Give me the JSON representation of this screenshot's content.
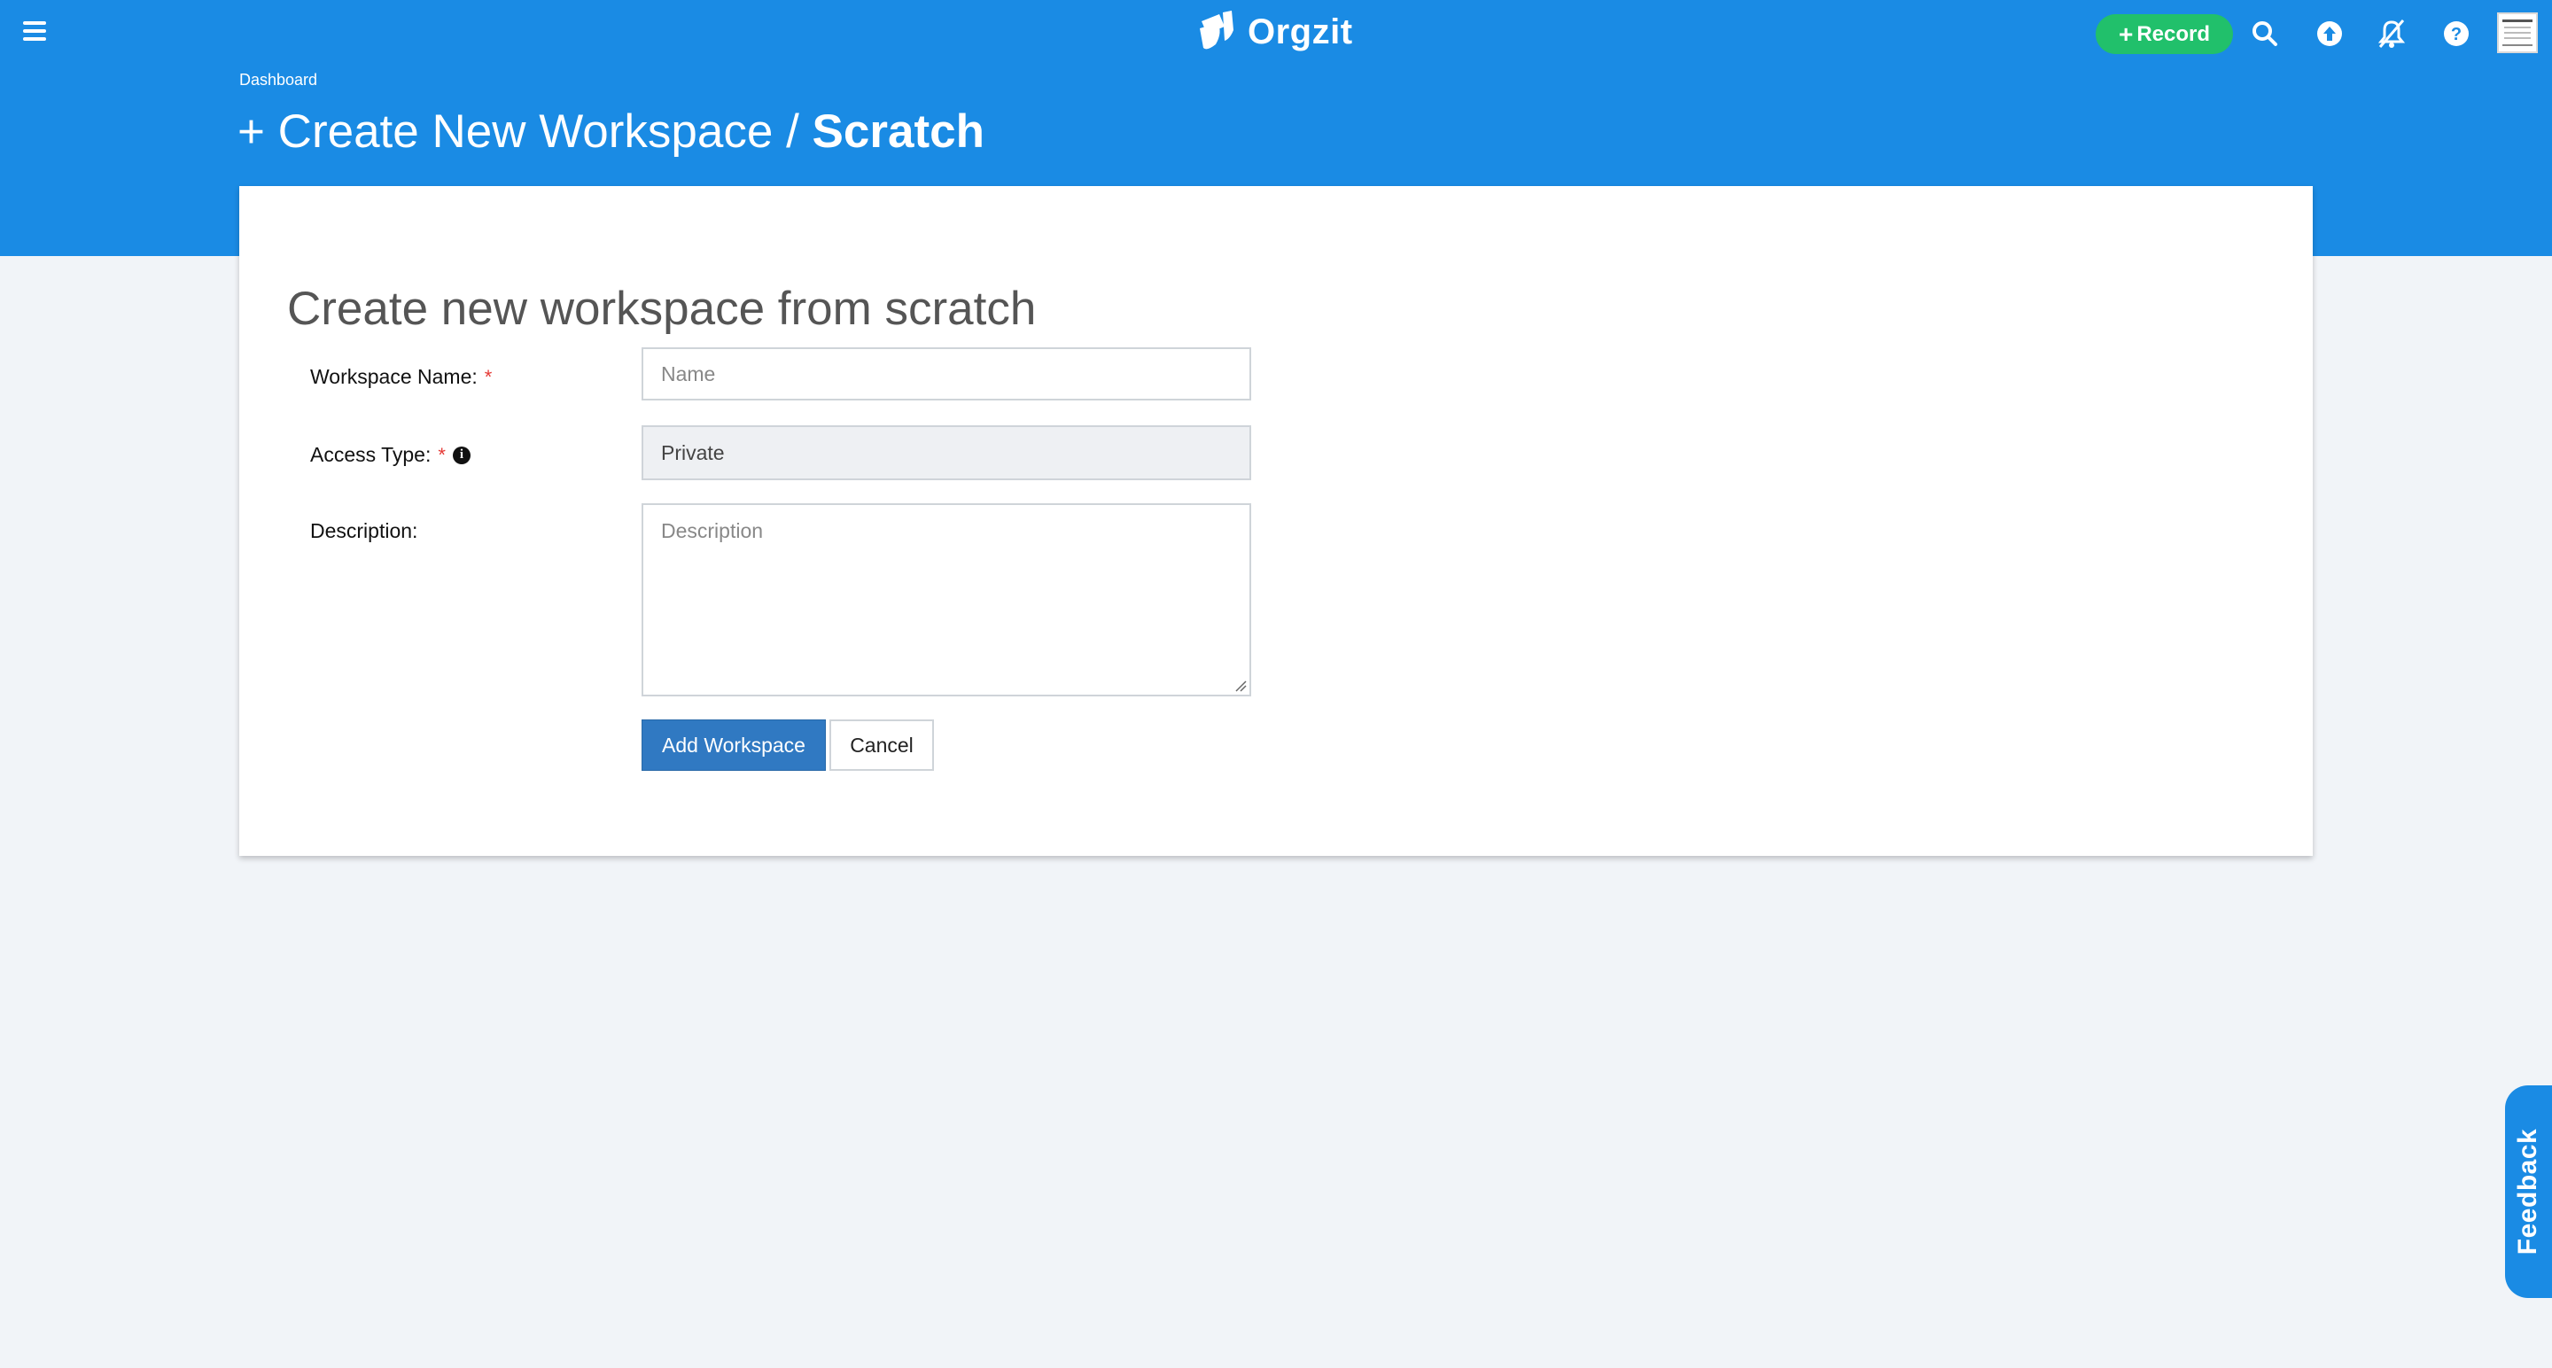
{
  "header": {
    "brand": "Orgzit",
    "record_label": "Record",
    "icons": [
      "menu-icon",
      "search-icon",
      "upload-icon",
      "notifications-off-icon",
      "help-icon",
      "avatar"
    ],
    "accent_color": "#1a8be4",
    "record_color": "#21c06b"
  },
  "breadcrumb": "Dashboard",
  "page_title": {
    "prefix": "+ Create New Workspace /",
    "current": "Scratch"
  },
  "form": {
    "heading": "Create new workspace from scratch",
    "workspace_name": {
      "label": "Workspace Name:",
      "required_mark": "*",
      "value": "",
      "placeholder": "Name"
    },
    "access_type": {
      "label": "Access Type:",
      "required_mark": "*",
      "info_icon": "i",
      "value": "Private"
    },
    "description": {
      "label": "Description:",
      "value": "",
      "placeholder": "Description"
    },
    "submit_label": "Add Workspace",
    "cancel_label": "Cancel"
  },
  "feedback_tab": "Feedback"
}
